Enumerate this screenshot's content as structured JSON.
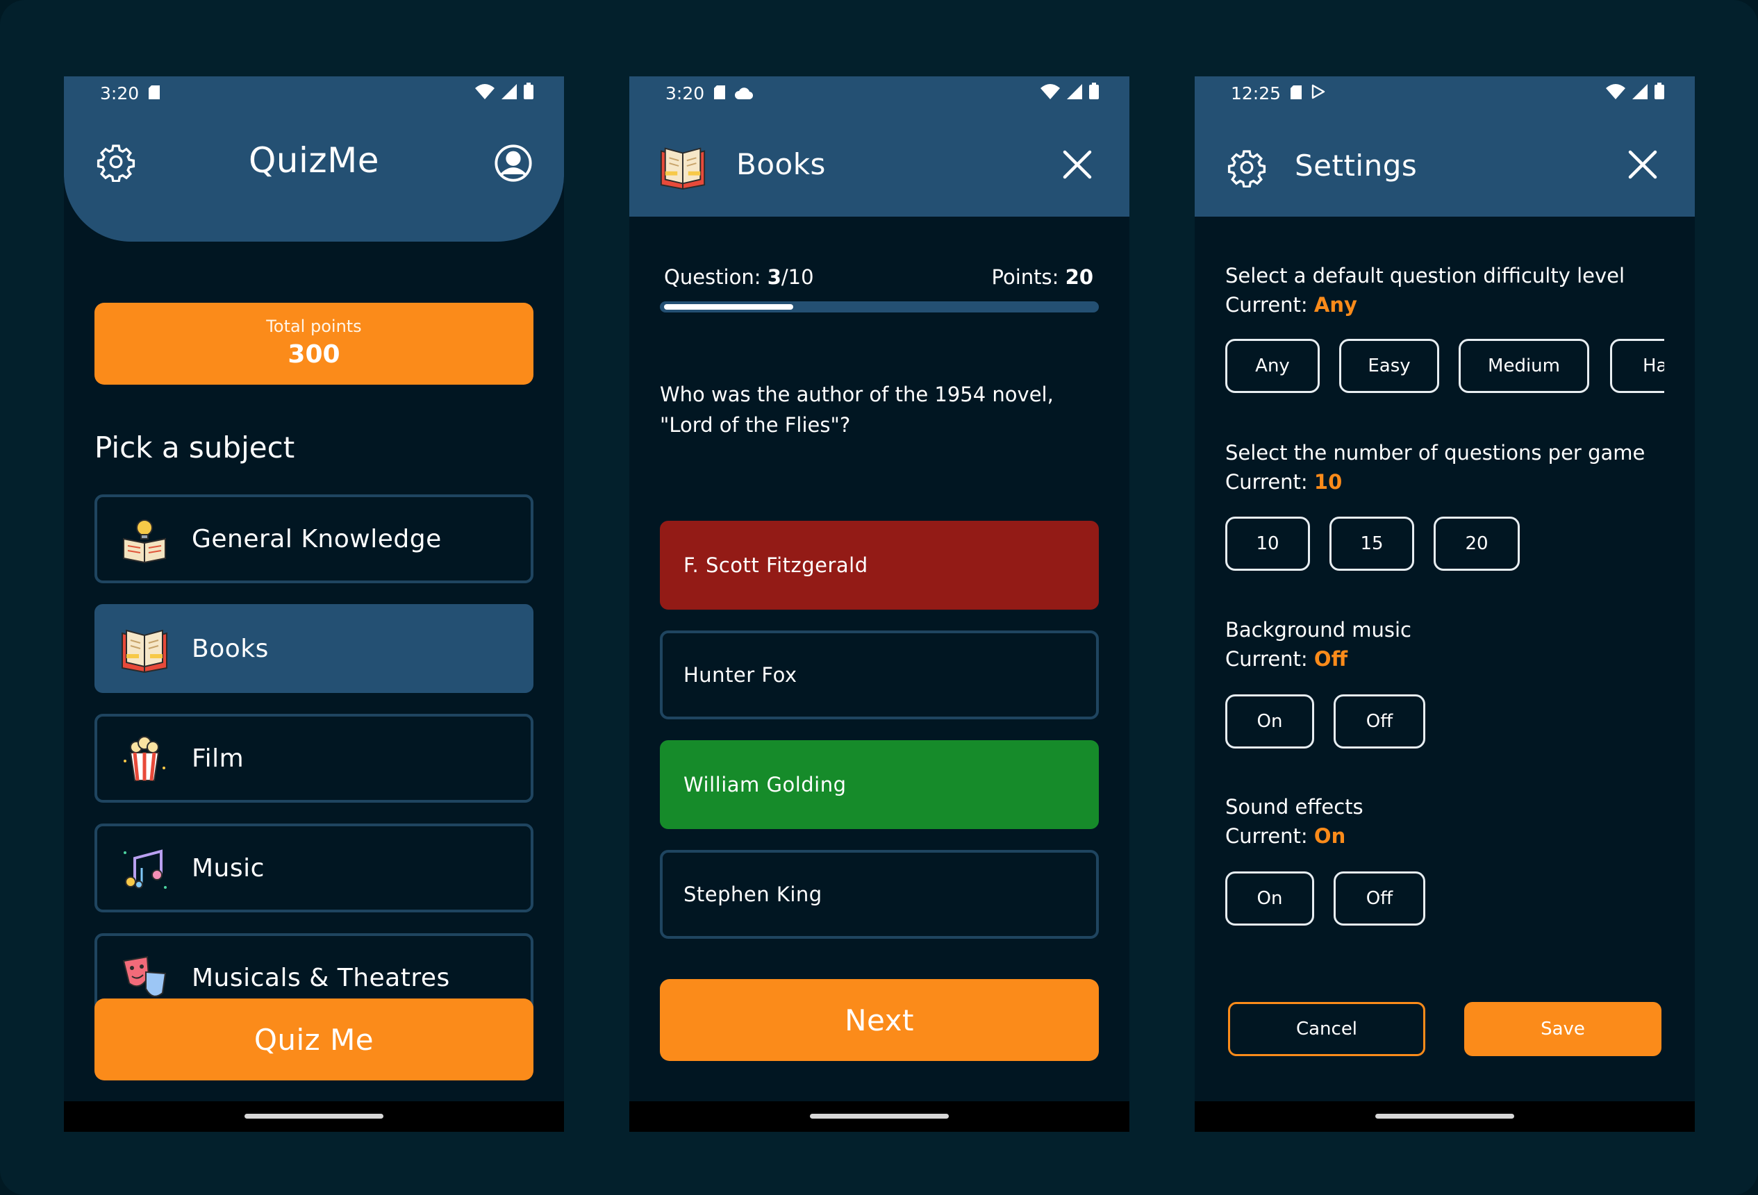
{
  "colors": {
    "background": "#03202c",
    "screen_background": "#011622",
    "app_bar": "#245073",
    "accent_orange": "#fb8b1a",
    "answer_wrong": "#931b16",
    "answer_correct": "#168b2a",
    "card_border": "#1f4560"
  },
  "home": {
    "status": {
      "time": "3:20",
      "left_icons": [
        "sd-card-icon"
      ],
      "right_icons": [
        "wifi-icon",
        "signal-icon",
        "battery-icon"
      ]
    },
    "app_title": "QuizMe",
    "settings_icon": "gear-icon",
    "profile_icon": "account-circle-icon",
    "points": {
      "label": "Total points",
      "value": "300"
    },
    "section_title": "Pick a subject",
    "subjects": [
      {
        "label": "General Knowledge",
        "icon": "book-lightbulb-icon",
        "selected": false
      },
      {
        "label": "Books",
        "icon": "book-icon",
        "selected": true
      },
      {
        "label": "Film",
        "icon": "popcorn-icon",
        "selected": false
      },
      {
        "label": "Music",
        "icon": "music-notes-icon",
        "selected": false
      },
      {
        "label": "Musicals & Theatres",
        "icon": "theatre-masks-icon",
        "selected": false
      }
    ],
    "quiz_button": "Quiz Me"
  },
  "quiz": {
    "status": {
      "time": "3:20",
      "left_icons": [
        "sd-card-icon",
        "cloud-icon"
      ],
      "right_icons": [
        "wifi-icon",
        "signal-icon",
        "battery-icon"
      ]
    },
    "title": "Books",
    "title_icon": "book-icon",
    "close_icon": "close-icon",
    "question_label": "Question:",
    "question_current": "3",
    "question_total": "/10",
    "points_label": "Points:",
    "points_value": "20",
    "progress_fraction": 0.3,
    "question": "Who was the author of the 1954 novel, \"Lord of the Flies\"?",
    "answers": [
      {
        "label": "F. Scott Fitzgerald",
        "state": "wrong"
      },
      {
        "label": "Hunter Fox",
        "state": "neutral"
      },
      {
        "label": "William Golding",
        "state": "correct"
      },
      {
        "label": "Stephen King",
        "state": "neutral"
      }
    ],
    "next_button": "Next"
  },
  "settings": {
    "status": {
      "time": "12:25",
      "left_icons": [
        "sd-card-icon",
        "play-store-icon"
      ],
      "right_icons": [
        "wifi-icon",
        "signal-icon",
        "battery-icon"
      ]
    },
    "title": "Settings",
    "title_icon": "gear-icon",
    "close_icon": "close-icon",
    "current_label": "Current:",
    "difficulty": {
      "label": "Select a default question difficulty level",
      "current": "Any",
      "options": [
        "Any",
        "Easy",
        "Medium",
        "Ha"
      ]
    },
    "questions": {
      "label": "Select the number of questions per game",
      "current": "10",
      "options": [
        "10",
        "15",
        "20"
      ]
    },
    "music": {
      "label": "Background music",
      "current": "Off",
      "options": [
        "On",
        "Off"
      ]
    },
    "sfx": {
      "label": "Sound effects",
      "current": "On",
      "options": [
        "On",
        "Off"
      ]
    },
    "cancel_button": "Cancel",
    "save_button": "Save"
  }
}
